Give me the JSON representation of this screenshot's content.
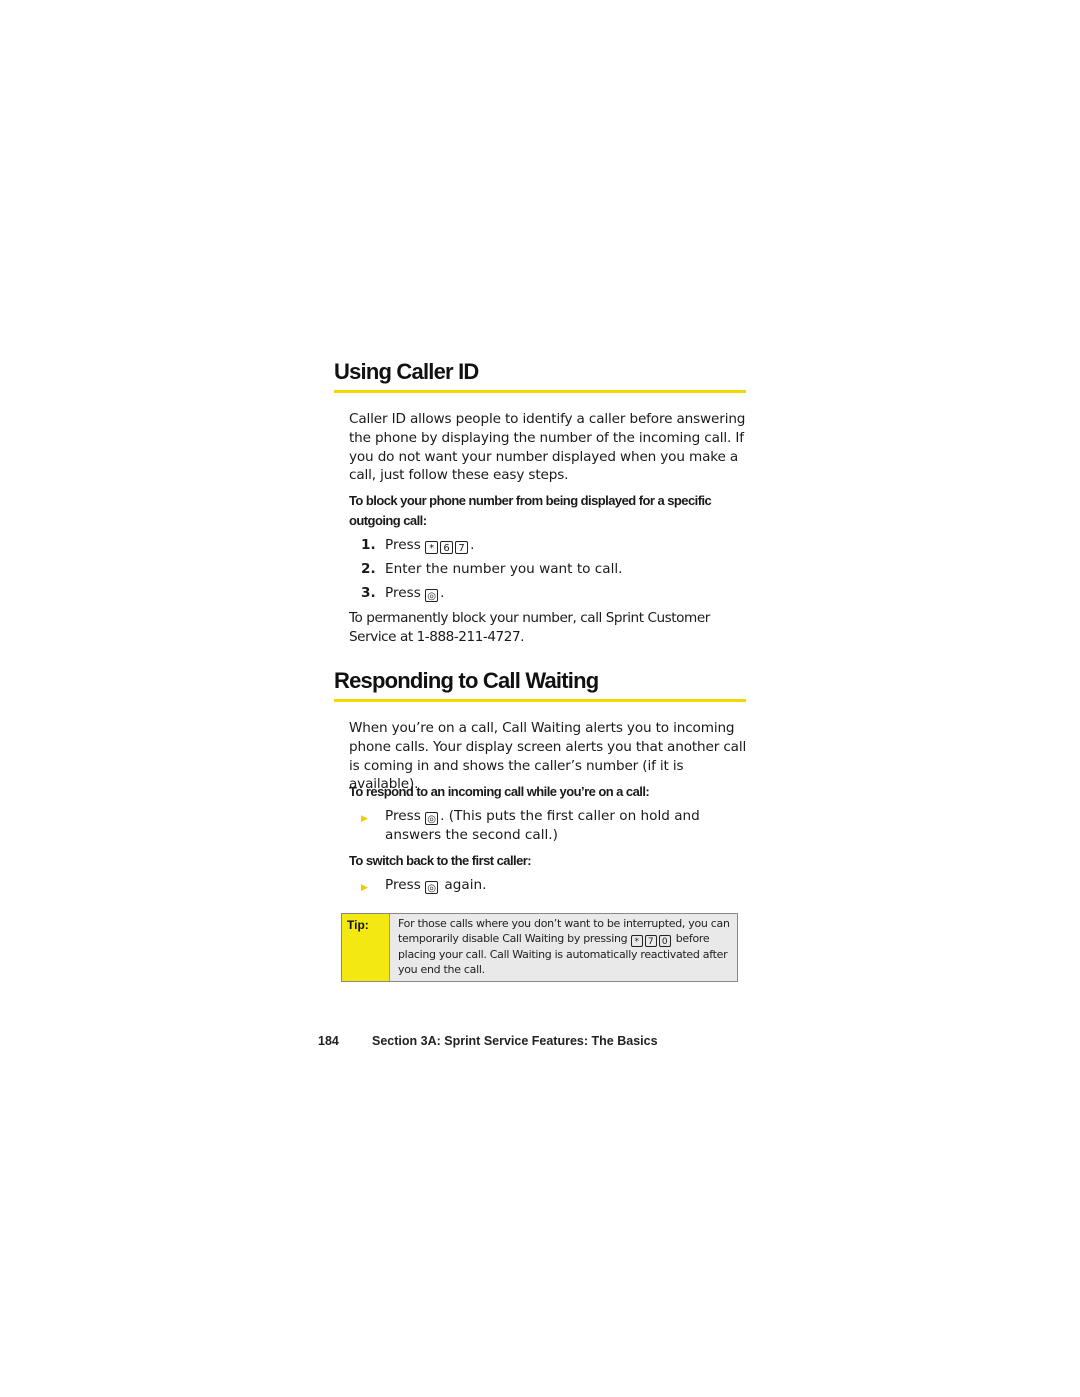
{
  "section1": {
    "title": "Using Caller ID",
    "intro": "Caller ID allows people to identify a caller before answering the phone by displaying the number of the incoming call. If you do not want your number displayed when you make a call, just follow these easy steps.",
    "subheading": "To block your phone number from being displayed for a specific outgoing call:",
    "steps": [
      {
        "num": "1.",
        "prefix": "Press",
        "keys": [
          "*",
          "6",
          "7"
        ],
        "suffix": "."
      },
      {
        "num": "2.",
        "text": "Enter the number you want to call."
      },
      {
        "num": "3.",
        "prefix": "Press",
        "keys": [
          "talk"
        ],
        "suffix": "."
      }
    ],
    "note": "To permanently block your number, call Sprint Customer Service at 1-888-211-4727."
  },
  "section2": {
    "title": "Responding to Call Waiting",
    "intro": "When you’re on a call, Call Waiting alerts you to incoming phone calls. Your display screen alerts you that another call is coming in and shows the caller’s number (if it is available).",
    "sub1": "To respond to an incoming call while you’re on a call:",
    "bullet1": {
      "prefix": "Press",
      "key": "talk",
      "suffix": ". (This puts the first caller on hold and answers the second call.)"
    },
    "sub2": "To switch back to the first caller:",
    "bullet2": {
      "prefix": "Press",
      "key": "talk",
      "suffix": " again."
    }
  },
  "tip": {
    "label": "Tip:",
    "text_before": "For those calls where you don’t want to be interrupted, you can temporarily disable Call Waiting by pressing",
    "keys": [
      "*",
      "7",
      "0"
    ],
    "text_after": "before placing your call. Call Waiting is automatically reactivated after you end the call."
  },
  "footer": {
    "page_number": "184",
    "section_title": "Section 3A: Sprint Service Features: The Basics"
  },
  "colors": {
    "accent_yellow": "#f5d800",
    "tip_label_bg": "#f3e812",
    "tip_bg": "#e9e9e9"
  }
}
